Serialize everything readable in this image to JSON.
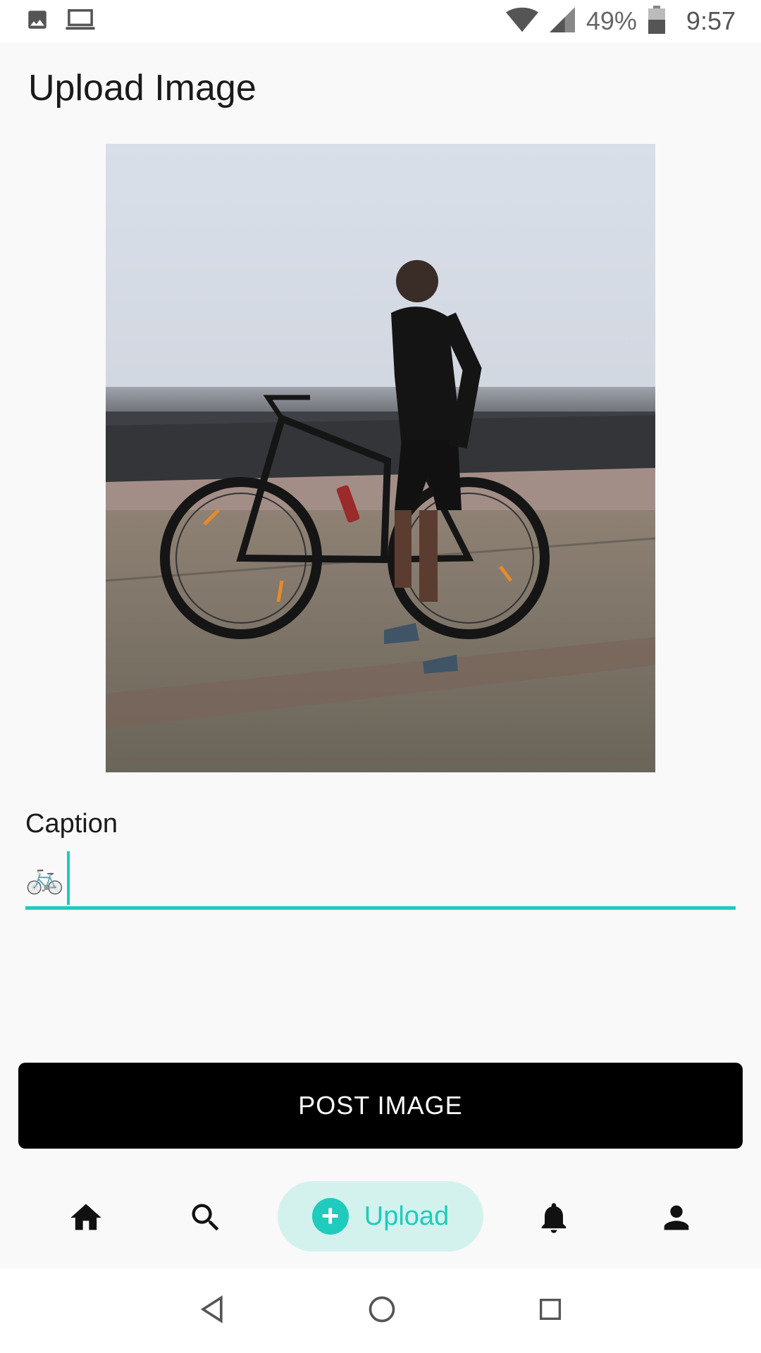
{
  "status_bar": {
    "battery_percent": "49%",
    "time": "9:57",
    "icons": [
      "image-icon",
      "laptop-icon",
      "wifi-icon",
      "signal-icon",
      "battery-icon"
    ]
  },
  "page": {
    "title": "Upload Image"
  },
  "photo": {
    "alt_description": "man with mountain bike by the sea"
  },
  "caption": {
    "label": "Caption",
    "value": "🚲"
  },
  "actions": {
    "post_label": "POST IMAGE"
  },
  "bottom_nav": {
    "items": [
      {
        "icon": "home-icon"
      },
      {
        "icon": "search-icon"
      },
      {
        "icon": "add-circle-icon",
        "label": "Upload",
        "selected": true
      },
      {
        "icon": "bell-icon"
      },
      {
        "icon": "person-icon"
      }
    ]
  },
  "colors": {
    "accent": "#1fcbbd",
    "accent_light": "#d3f2ee",
    "button": "#000000",
    "background": "#f9f9f9"
  }
}
